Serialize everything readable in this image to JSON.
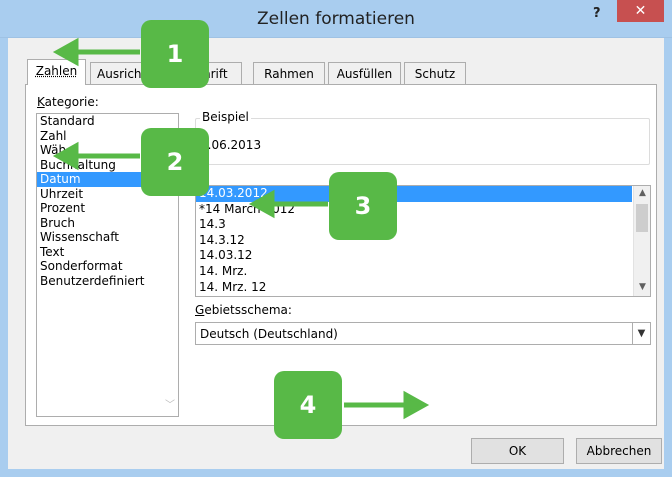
{
  "window": {
    "title": "Zellen formatieren",
    "help_glyph": "?",
    "close_glyph": "✕"
  },
  "tabs": [
    {
      "label": "Zahlen",
      "active": true
    },
    {
      "label": "Ausrichtung",
      "visible": "Ausrich"
    },
    {
      "label": "Schrift",
      "visible": "hrift"
    },
    {
      "label": "Rahmen"
    },
    {
      "label": "Ausfüllen"
    },
    {
      "label": "Schutz"
    }
  ],
  "kategorie": {
    "label_underlined": "K",
    "label_rest": "ategorie:",
    "items": [
      "Standard",
      "Zahl",
      "Währung",
      "Buchhaltung",
      "Datum",
      "Uhrzeit",
      "Prozent",
      "Bruch",
      "Wissenschaft",
      "Text",
      "Sonderformat",
      "Benutzerdefiniert"
    ],
    "visible_items": [
      "Standard",
      "Zahl",
      "Wäh",
      "Buchhaltung",
      "Datum",
      "Uhrzeit",
      "Prozent",
      "Bruch",
      "Wissenschaft",
      "Text",
      "Sonderformat",
      "Benutzerdefiniert"
    ],
    "selected_index": 4
  },
  "beispiel": {
    "label": "Beispiel",
    "value": "01.06.2013",
    "value_visible": "1.06.2013"
  },
  "typ": {
    "label": "Typ:",
    "label_visible": "p:",
    "items": [
      "*14.03.2012",
      "*14 March 2012",
      "14.3",
      "14.3.12",
      "14.03.12",
      "14. Mrz.",
      "14. Mrz. 12"
    ],
    "visible_items": [
      "14.03.2012",
      "*14 March 2012",
      "14.3",
      "14.3.12",
      "14.03.12",
      "14. Mrz.",
      "14. Mrz. 12"
    ],
    "selected_index": 0
  },
  "gebietsschema": {
    "label_underlined": "G",
    "label_rest": "ebietsschema:",
    "value": "Deutsch (Deutschland)"
  },
  "buttons": {
    "ok": "OK",
    "cancel": "Abbrechen"
  },
  "callouts": [
    "1",
    "2",
    "3",
    "4"
  ],
  "colors": {
    "titlebar": "#a9cdef",
    "close": "#c75050",
    "selection": "#3399ff",
    "callout": "#58b947"
  }
}
